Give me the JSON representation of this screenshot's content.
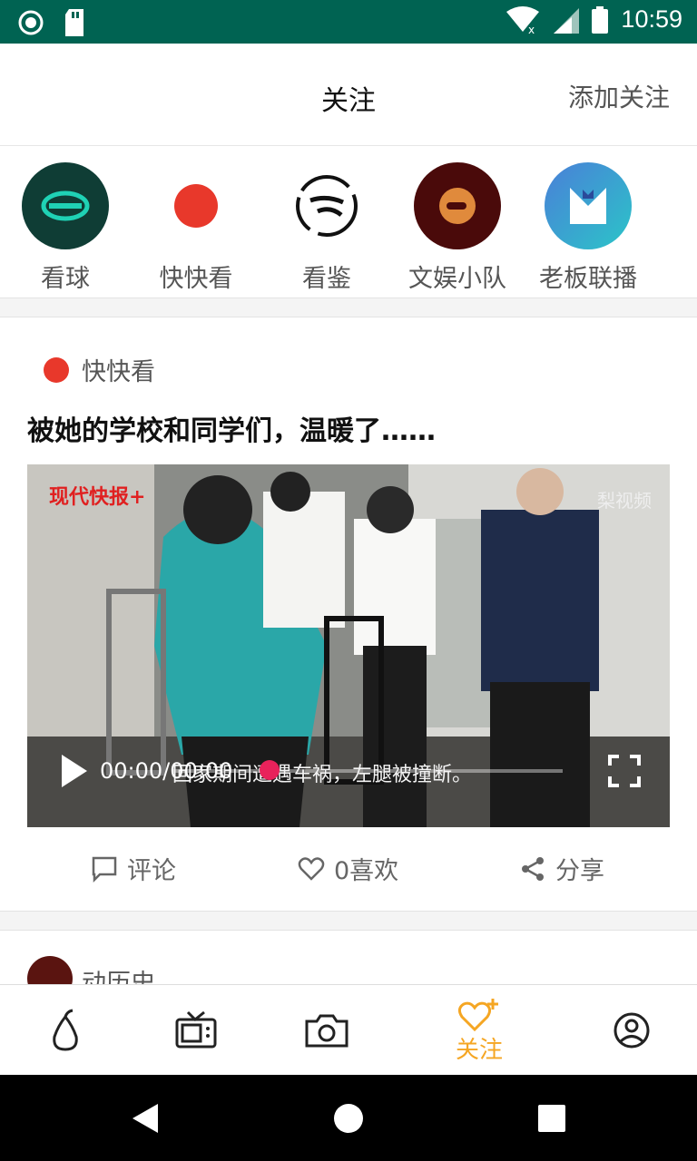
{
  "status_bar": {
    "time": "10:59",
    "bg_color": "#006352"
  },
  "header": {
    "title": "关注",
    "add_follow": "添加关注"
  },
  "followed": [
    {
      "name": "看球",
      "color": "#0f3d35"
    },
    {
      "name": "快快看",
      "color": "#e8382b"
    },
    {
      "name": "看鉴",
      "color": "#ffffff"
    },
    {
      "name": "文娱小队",
      "color": "#4a0a0a"
    },
    {
      "name": "老板联播",
      "color": "#4a7fd8"
    }
  ],
  "post": {
    "source": "快快看",
    "headline": "被她的学校和同学们，温暖了……",
    "video": {
      "watermark_left": "现代快报+",
      "watermark_right": "梨视频",
      "time": "00:00/00:00",
      "subtitle": "回家期间遭遇车祸，左腿被撞断。",
      "progress_fraction": 0
    },
    "actions": {
      "comment": "评论",
      "like": "0喜欢",
      "share": "分享"
    }
  },
  "next_post": {
    "source": "动历史"
  },
  "bottom_nav": {
    "active_label": "关注",
    "active_color": "#f5a623"
  }
}
